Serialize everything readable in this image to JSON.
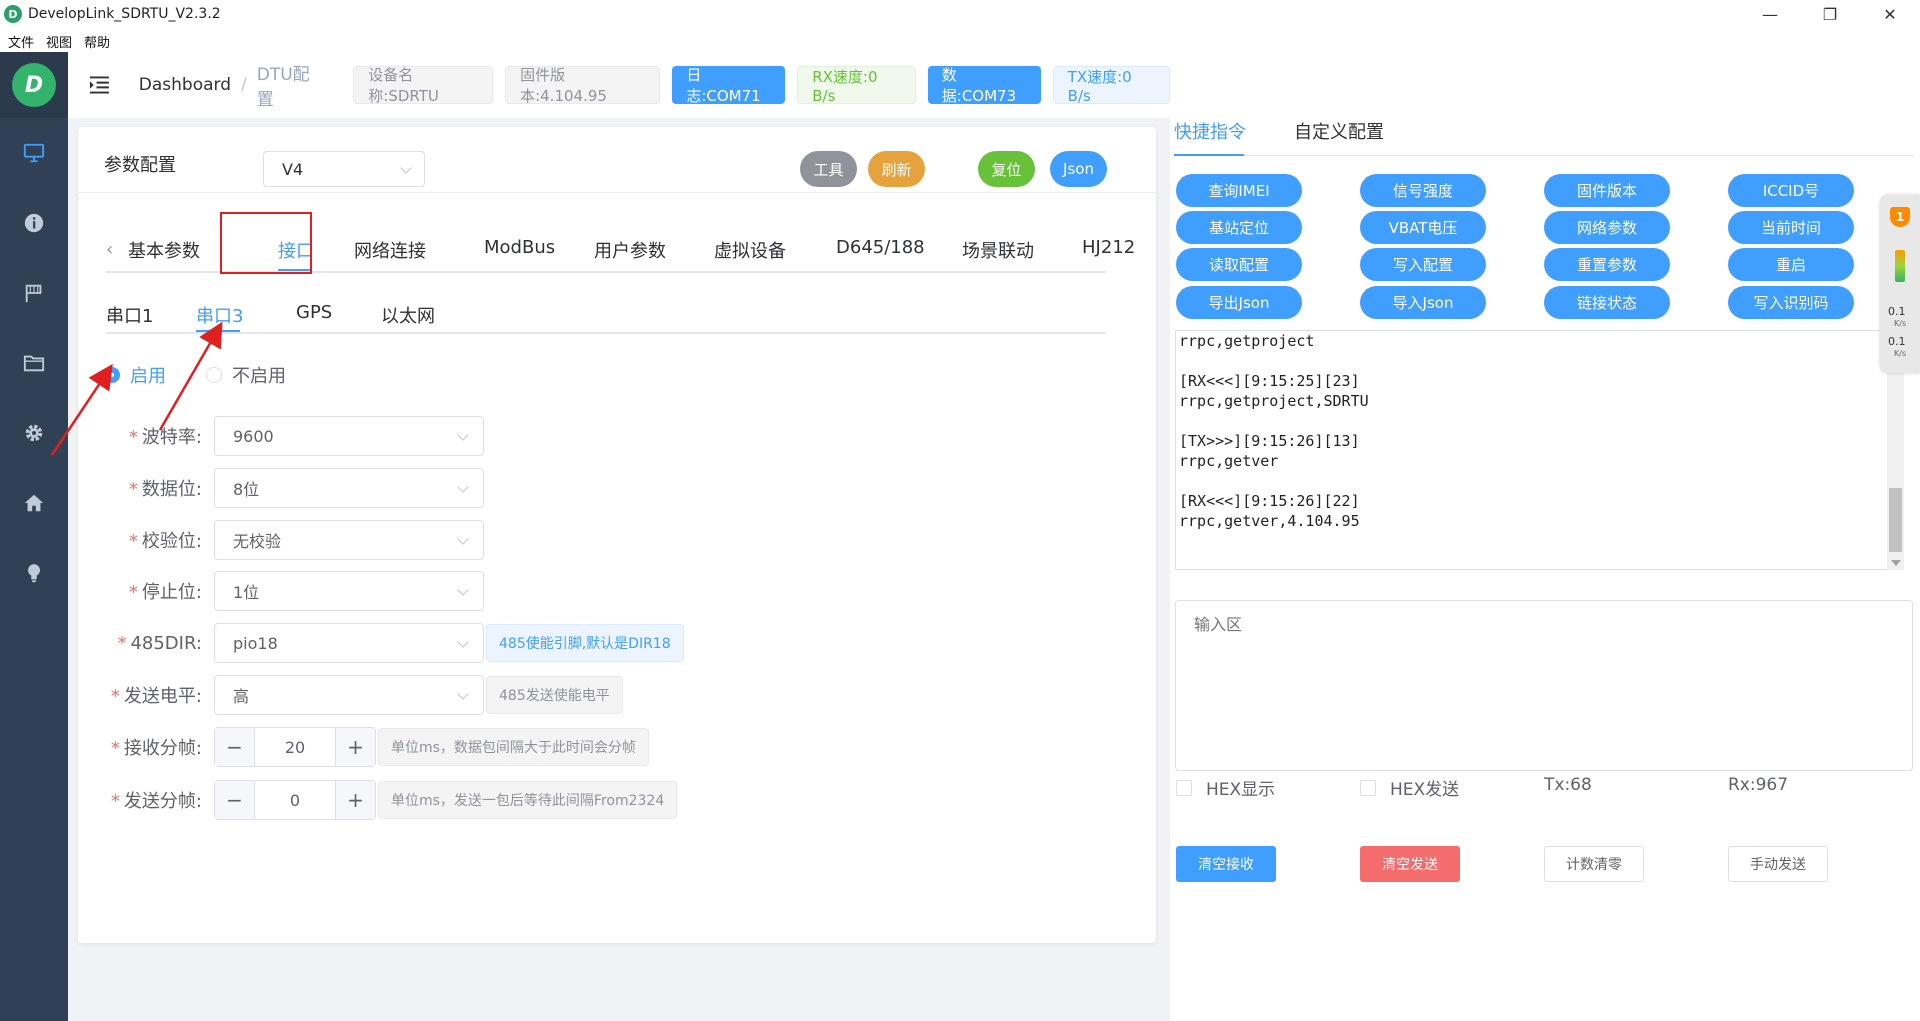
{
  "window": {
    "title": "DevelopLink_SDRTU_V2.3.2",
    "icon_letter": "D"
  },
  "menu": [
    "文件",
    "视图",
    "帮助"
  ],
  "logo_letter": "D",
  "sidebar_icons": [
    "monitor-icon",
    "info-icon",
    "flag-icon",
    "folder-icon",
    "gear-icon",
    "home-icon",
    "bulb-icon"
  ],
  "header": {
    "breadcrumb_home": "Dashboard",
    "breadcrumb_sep": "/",
    "breadcrumb_current": "DTU配置",
    "device_name": "设备名称:SDRTU",
    "firmware": "固件版本:4.104.95",
    "log_port": "日志:COM71",
    "rx_speed": "RX速度:0 B/s",
    "data_port": "数据:COM73",
    "tx_speed": "TX速度:0 B/s"
  },
  "params": {
    "title": "参数配置",
    "version": "V4",
    "buttons": {
      "tools": "工具",
      "refresh": "刷新",
      "reset": "复位",
      "json": "Json"
    }
  },
  "main_tabs": {
    "prev": "‹",
    "items": [
      "基本参数",
      "接口",
      "网络连接",
      "ModBus",
      "用户参数",
      "虚拟设备",
      "D645/188",
      "场景联动",
      "HJ212"
    ]
  },
  "sub_tabs": [
    "串口1",
    "串口3",
    "GPS",
    "以太网"
  ],
  "enable": {
    "on": "启用",
    "off": "不启用"
  },
  "form": {
    "baud": {
      "label": "波特率:",
      "value": "9600"
    },
    "databits": {
      "label": "数据位:",
      "value": "8位"
    },
    "parity": {
      "label": "校验位:",
      "value": "无校验"
    },
    "stopbits": {
      "label": "停止位:",
      "value": "1位"
    },
    "dir485": {
      "label": "485DIR:",
      "value": "pio18",
      "hint": "485使能引脚,默认是DIR18"
    },
    "level": {
      "label": "发送电平:",
      "value": "高",
      "hint": "485发送使能电平"
    },
    "rx_frame": {
      "label": "接收分帧:",
      "value": "20",
      "hint": "单位ms，数据包间隔大于此时间会分帧"
    },
    "tx_frame": {
      "label": "发送分帧:",
      "value": "0",
      "hint": "单位ms，发送一包后等待此间隔From2324"
    },
    "minus": "−",
    "plus": "+"
  },
  "right": {
    "tabs": [
      "快捷指令",
      "自定义配置"
    ],
    "quick": [
      "查询IMEI",
      "信号强度",
      "固件版本",
      "ICCID号",
      "基站定位",
      "VBAT电压",
      "网络参数",
      "当前时间",
      "读取配置",
      "写入配置",
      "重置参数",
      "重启",
      "导出Json",
      "导入Json",
      "链接状态",
      "写入识别码"
    ],
    "log": "rrpc,getproject\n\n[RX<<<][9:15:25][23]\nrrpc,getproject,SDRTU\n\n[TX>>>][9:15:26][13]\nrrpc,getver\n\n[RX<<<][9:15:26][22]\nrrpc,getver,4.104.95",
    "input_placeholder": "输入区",
    "hex_show": "HEX显示",
    "hex_send": "HEX发送",
    "tx_count": "Tx:68",
    "rx_count": "Rx:967",
    "clear_rx": "清空接收",
    "clear_tx": "清空发送",
    "count_reset": "计数清零",
    "manual_send": "手动发送"
  },
  "speed_widget": {
    "badge": "1",
    "up": "0.1",
    "down": "0.1",
    "unit": "K/s"
  },
  "colors": {
    "primary": "#409eff",
    "sidebar": "#304156",
    "success": "#67c23a",
    "warning": "#e6a23c",
    "danger": "#f56c6c",
    "annotation": "#e02020"
  }
}
